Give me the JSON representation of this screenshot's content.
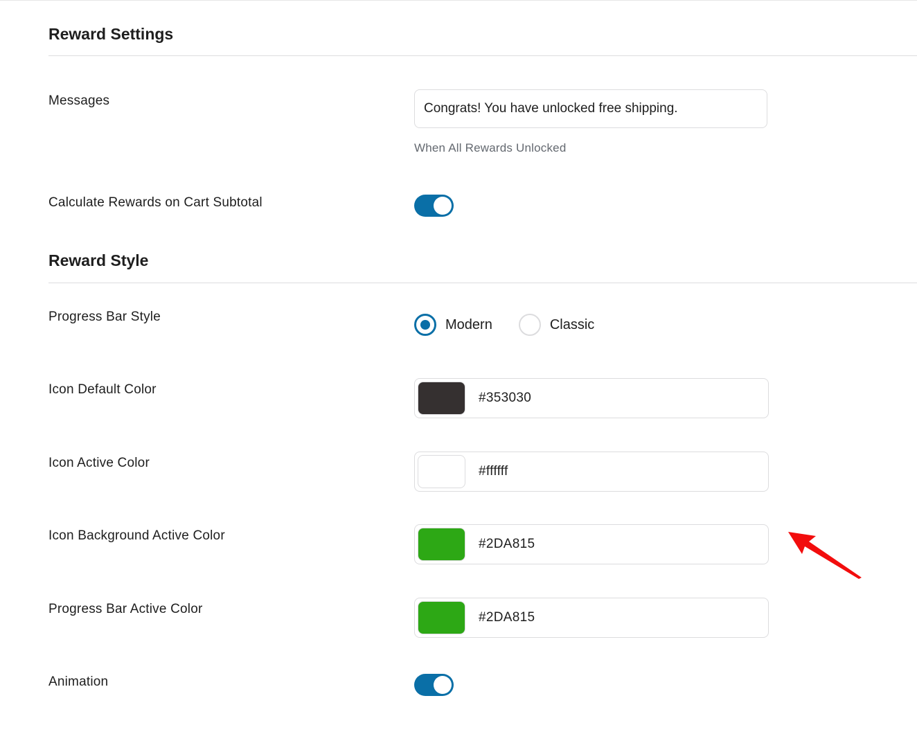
{
  "reward_settings": {
    "title": "Reward Settings",
    "messages_label": "Messages",
    "messages_value": "Congrats! You have unlocked free shipping.",
    "messages_help": "When All Rewards Unlocked",
    "calc_subtotal_label": "Calculate Rewards on Cart Subtotal",
    "calc_subtotal_enabled": true
  },
  "reward_style": {
    "title": "Reward Style",
    "progress_style_label": "Progress Bar Style",
    "progress_style_options": [
      "Modern",
      "Classic"
    ],
    "progress_style_selected": "Modern",
    "icon_default_color_label": "Icon Default Color",
    "icon_default_color": "#353030",
    "icon_active_color_label": "Icon Active Color",
    "icon_active_color": "#ffffff",
    "icon_bg_active_color_label": "Icon Background Active Color",
    "icon_bg_active_color": "#2DA815",
    "progress_active_color_label": "Progress Bar Active Color",
    "progress_active_color": "#2DA815",
    "animation_label": "Animation",
    "animation_enabled": true
  },
  "colors": {
    "accent": "#0a6fa7",
    "annotation_arrow": "#f20d0d"
  },
  "icons": {
    "annotation": "red-arrow-icon"
  }
}
